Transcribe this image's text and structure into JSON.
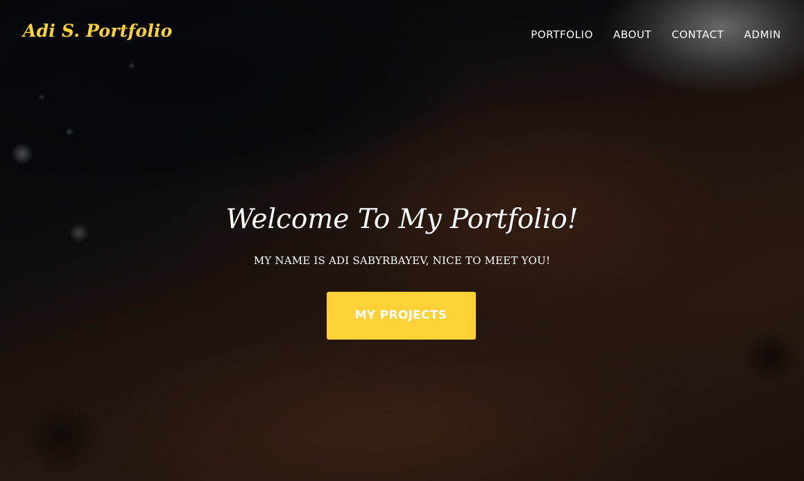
{
  "brand": {
    "name": "Adi S. Portfolio",
    "color": "#fed136"
  },
  "nav": {
    "items": [
      {
        "label": "PORTFOLIO"
      },
      {
        "label": "ABOUT"
      },
      {
        "label": "CONTACT"
      },
      {
        "label": "ADMIN"
      }
    ]
  },
  "hero": {
    "lead_in": "Welcome To My Portfolio!",
    "heading": "MY NAME IS ADI SABYRBAYEV, NICE TO MEET YOU!",
    "cta_label": "MY PROJECTS",
    "cta_color": "#fed136"
  }
}
